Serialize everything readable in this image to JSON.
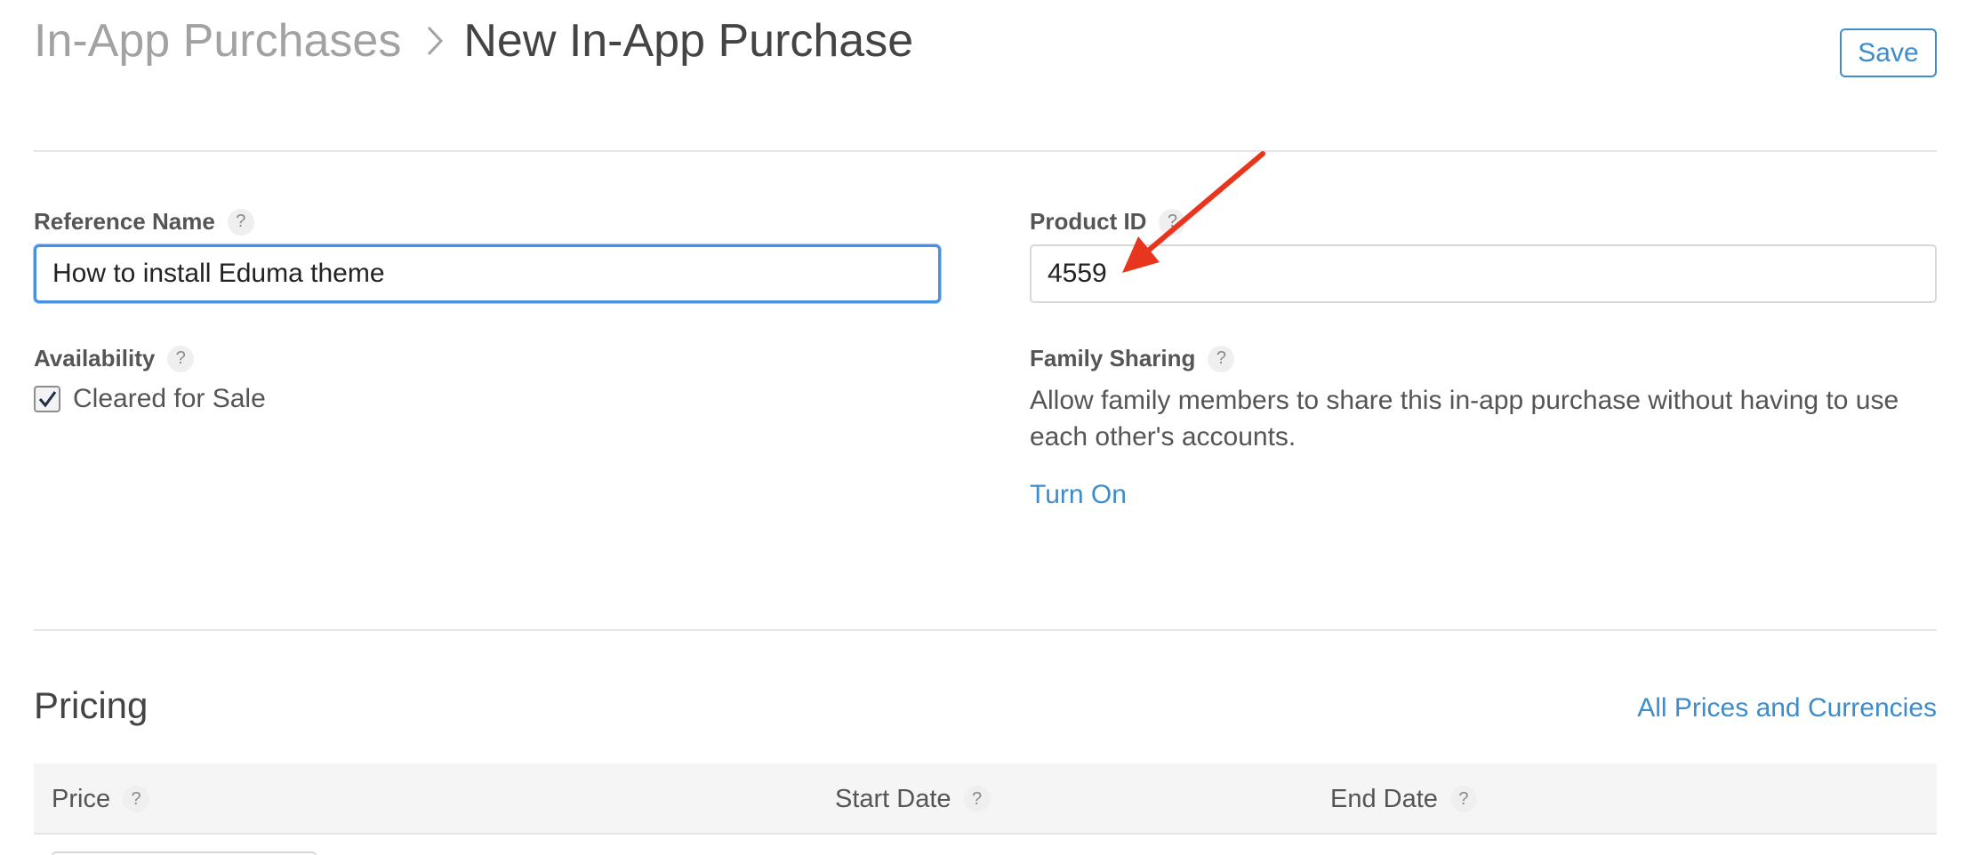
{
  "header": {
    "breadcrumb_parent": "In-App Purchases",
    "title": "New In-App Purchase",
    "save_label": "Save"
  },
  "form": {
    "reference_name": {
      "label": "Reference Name",
      "value": "How to install Eduma theme"
    },
    "product_id": {
      "label": "Product ID",
      "value": "4559"
    },
    "availability": {
      "label": "Availability",
      "checkbox_label": "Cleared for Sale",
      "checked": true
    },
    "family_sharing": {
      "label": "Family Sharing",
      "description": "Allow family members to share this in-app purchase without having to use each other's accounts.",
      "action": "Turn On"
    },
    "help_glyph": "?"
  },
  "pricing": {
    "title": "Pricing",
    "link": "All Prices and Currencies",
    "columns": [
      "Price",
      "Start Date",
      "End Date"
    ]
  },
  "colors": {
    "accent": "#3d8ccc",
    "focus": "#4a90e2",
    "annotation": "#e8351e"
  },
  "icons": {
    "breadcrumb_separator": "chevron-right-icon",
    "help": "question-mark-icon",
    "checkbox": "checkmark-icon",
    "annotation": "red-arrow-icon"
  }
}
